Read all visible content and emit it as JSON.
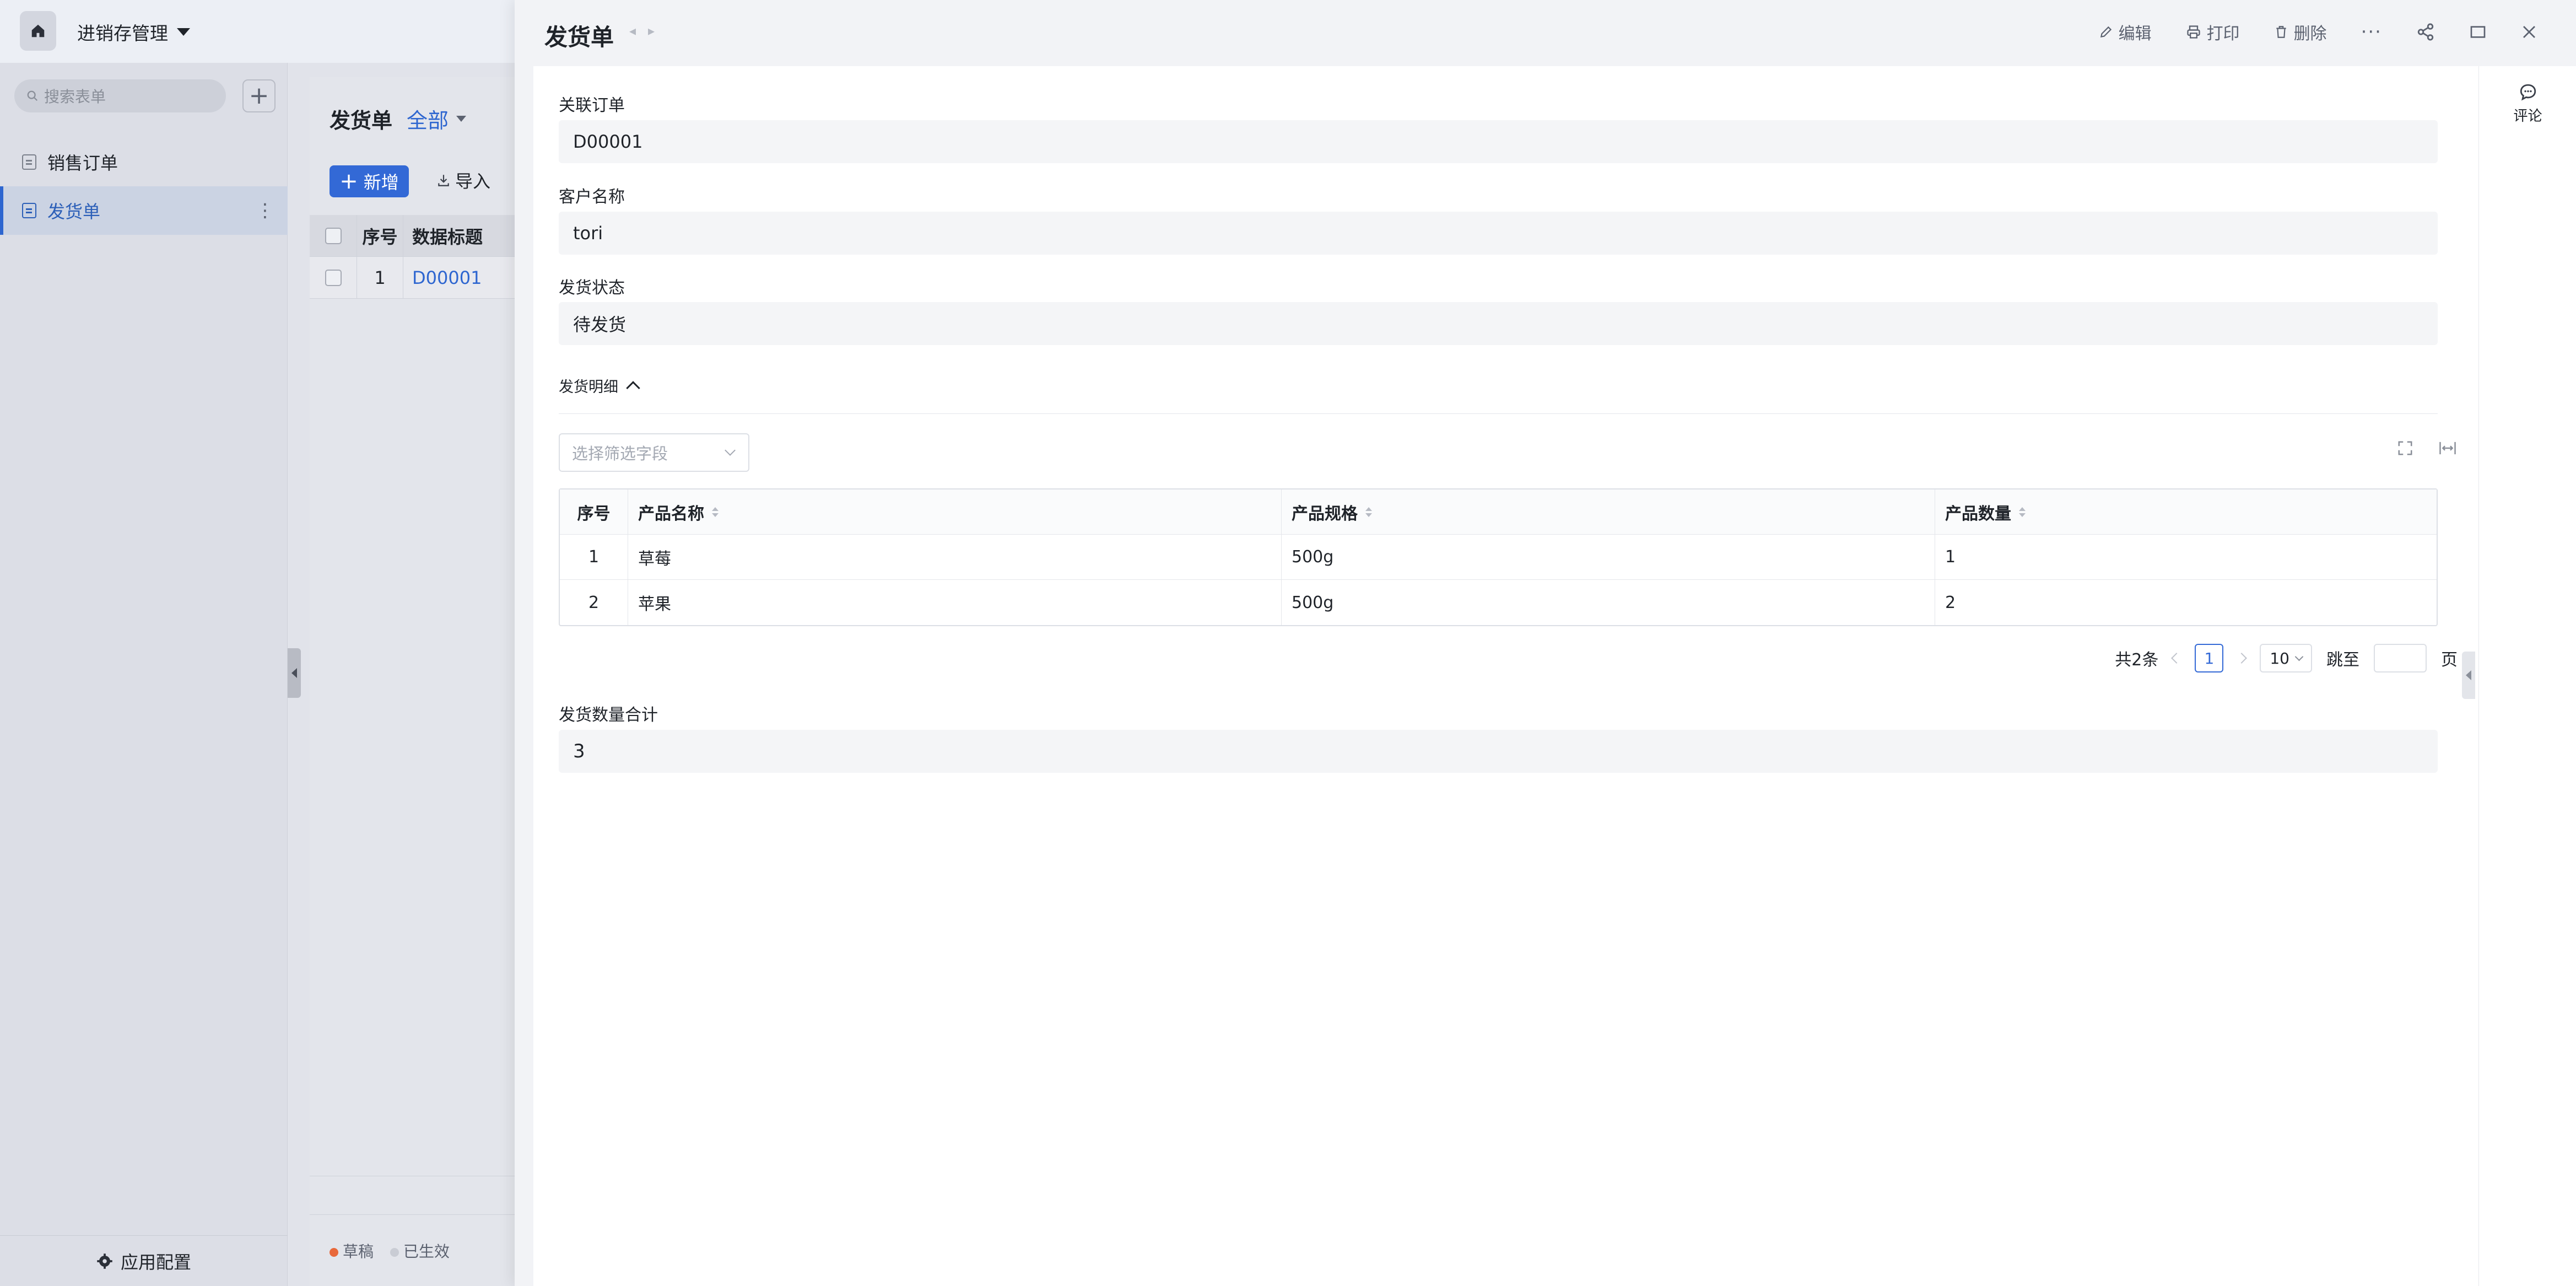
{
  "app": {
    "title": "进销存管理",
    "home_icon": "home-icon"
  },
  "sidebar": {
    "search_placeholder": "搜索表单",
    "items": [
      {
        "label": "销售订单"
      },
      {
        "label": "发货单"
      }
    ],
    "footer_label": "应用配置"
  },
  "list_view": {
    "title": "发货单",
    "view_name": "全部",
    "new_button": "新增",
    "import_button": "导入",
    "columns": [
      "序号",
      "数据标题"
    ],
    "rows": [
      {
        "index": "1",
        "title": "D00001"
      }
    ],
    "status_legend": [
      {
        "label": "草稿",
        "color": "#e8683a"
      },
      {
        "label": "已生效",
        "color": "#c9ccd4"
      }
    ]
  },
  "drawer": {
    "title": "发货单",
    "actions": {
      "edit": "编辑",
      "print": "打印",
      "delete": "删除"
    },
    "fields": {
      "order_label": "关联订单",
      "order_value": "D00001",
      "customer_label": "客户名称",
      "customer_value": "tori",
      "status_label": "发货状态",
      "status_value": "待发货"
    },
    "detail_section": {
      "title": "发货明细",
      "filter_placeholder": "选择筛选字段",
      "columns": [
        "序号",
        "产品名称",
        "产品规格",
        "产品数量"
      ],
      "rows": [
        {
          "index": "1",
          "name": "草莓",
          "spec": "500g",
          "qty": "1"
        },
        {
          "index": "2",
          "name": "苹果",
          "spec": "500g",
          "qty": "2"
        }
      ],
      "pagination": {
        "total": "共2条",
        "current_page": "1",
        "page_size": "10",
        "jump_label": "跳至",
        "page_unit": "页"
      }
    },
    "total_label": "发货数量合计",
    "total_value": "3",
    "comment_label": "评论"
  },
  "colors": {
    "accent": "#3369d6",
    "draft": "#e8683a"
  }
}
